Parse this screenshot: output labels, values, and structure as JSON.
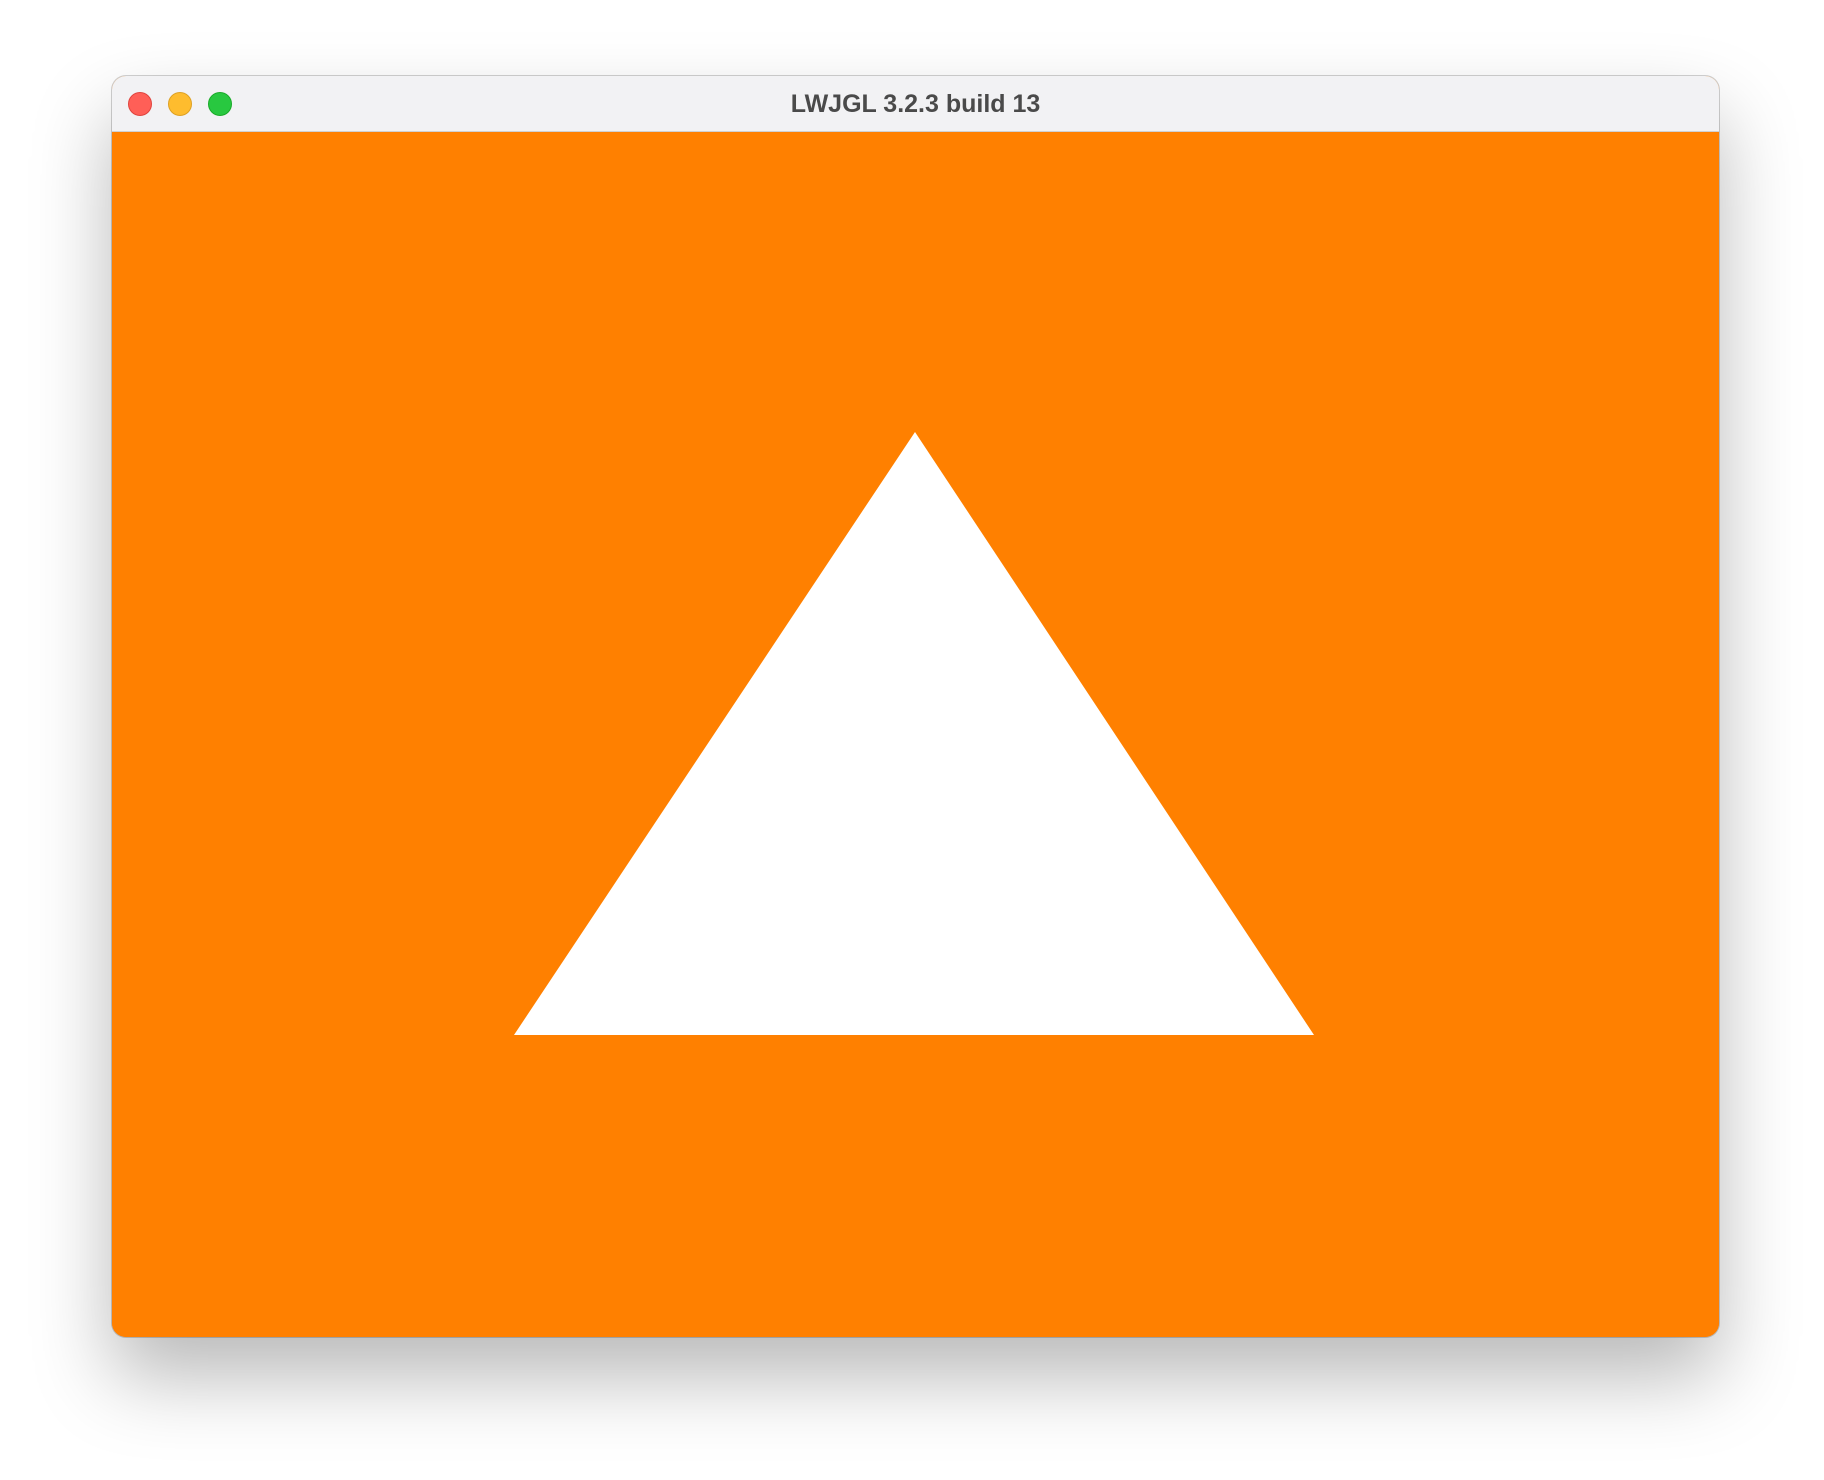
{
  "window": {
    "title": "LWJGL 3.2.3 build 13"
  },
  "traffic_lights": {
    "close": {
      "color": "#ff5f57",
      "icon": "close-icon"
    },
    "minimize": {
      "color": "#febc2e",
      "icon": "minimize-icon"
    },
    "maximize": {
      "color": "#28c840",
      "icon": "maximize-icon"
    }
  },
  "canvas": {
    "clear_color": "#ff8000",
    "shape": {
      "type": "triangle",
      "fill": "#ffffff"
    }
  }
}
